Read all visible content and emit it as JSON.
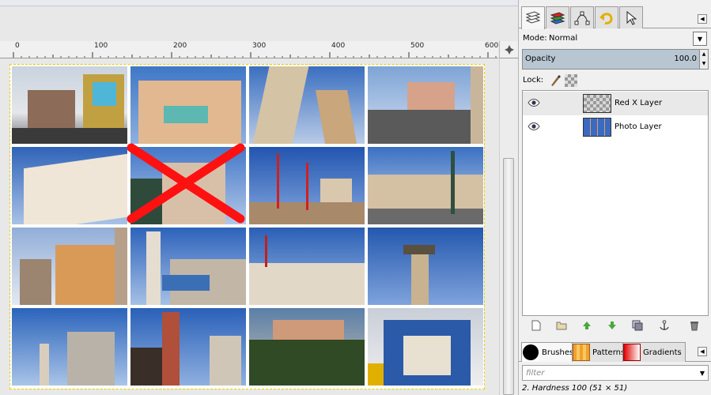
{
  "ruler": {
    "labels": [
      "0",
      "100",
      "200",
      "300",
      "400",
      "500",
      "600"
    ]
  },
  "dock": {
    "tabs": [
      {
        "icon": "layers-icon"
      },
      {
        "icon": "channels-icon"
      },
      {
        "icon": "paths-icon"
      },
      {
        "icon": "undo-history-icon"
      },
      {
        "icon": "pointer-icon"
      }
    ],
    "mode_label": "Mode:",
    "mode_value": "Normal",
    "opacity_label": "Opacity",
    "opacity_value": "100.0",
    "lock_label": "Lock:",
    "layers": [
      {
        "name": "Red X Layer",
        "visible": true,
        "selected": true
      },
      {
        "name": "Photo Layer",
        "visible": true,
        "selected": false
      }
    ],
    "layer_buttons": [
      "new-layer-icon",
      "new-layer-group-icon",
      "raise-layer-icon",
      "lower-layer-icon",
      "duplicate-layer-icon",
      "anchor-layer-icon",
      "delete-layer-icon"
    ]
  },
  "brushes": {
    "tabs": [
      {
        "label": "Brushes",
        "icon": "brush-preview-icon"
      },
      {
        "label": "Patterns",
        "icon": "pattern-preview-icon"
      },
      {
        "label": "Gradients",
        "icon": "gradient-preview-icon"
      }
    ],
    "filter_placeholder": "filter",
    "brush_info": "2. Hardness 100 (51 × 51)"
  },
  "colors": {
    "red_x": "#ff1111",
    "selection_bg": "#b8c6d2"
  }
}
